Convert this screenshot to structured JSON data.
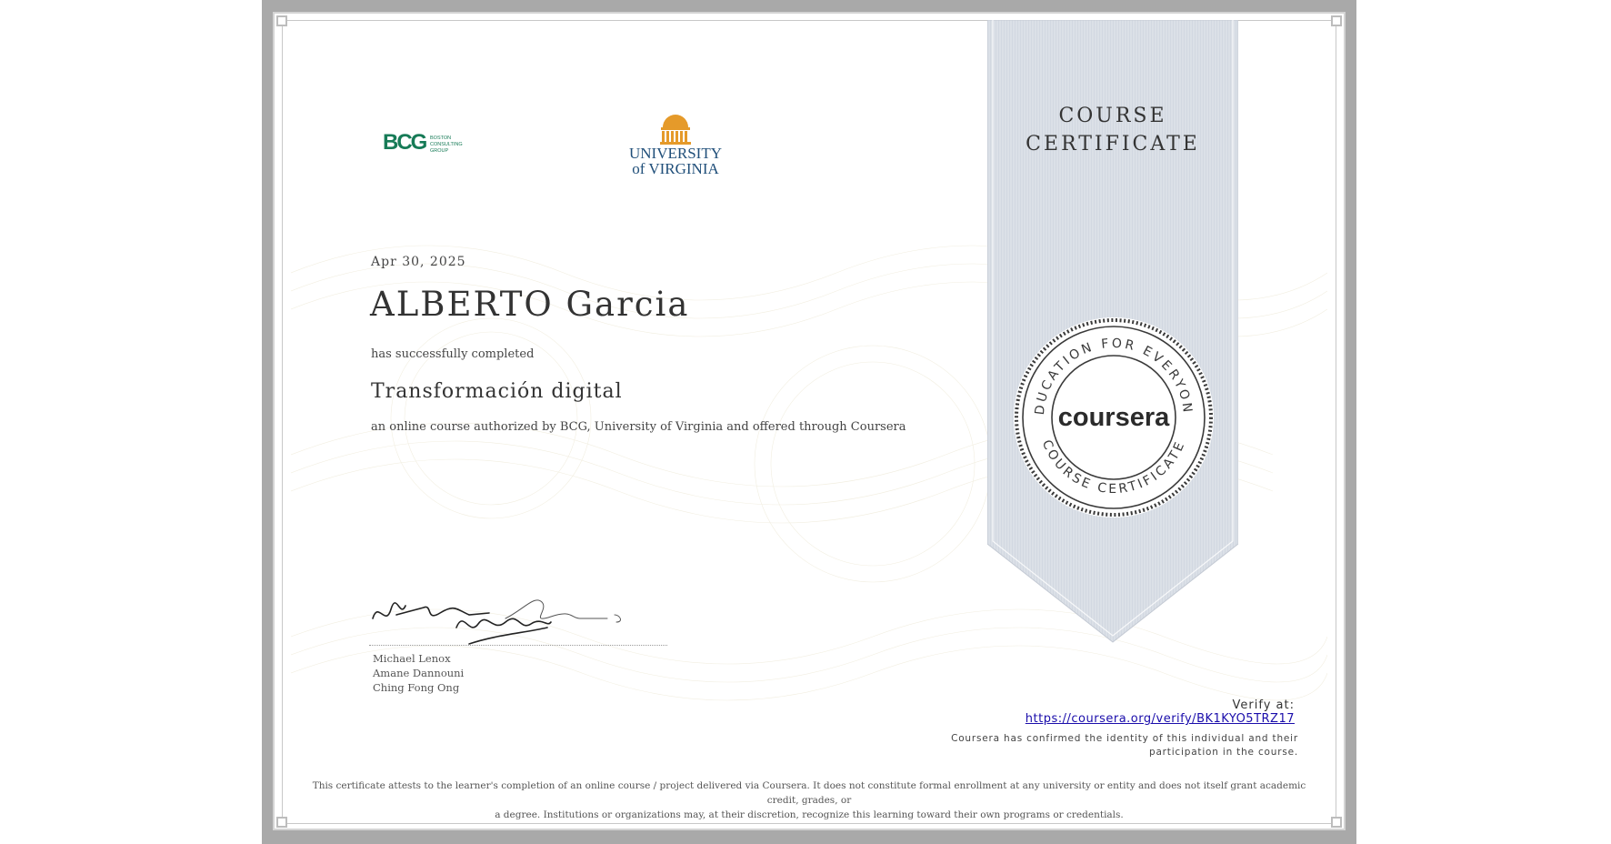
{
  "logos": {
    "bcg_mark": "BCG",
    "bcg_text": [
      "BOSTON",
      "CONSULTING",
      "GROUP"
    ],
    "uva_line1": "UNIVERSITY",
    "uva_line2": "of VIRGINIA"
  },
  "certificate": {
    "ribbon_title_line1": "COURSE",
    "ribbon_title_line2": "CERTIFICATE",
    "date": "Apr 30, 2025",
    "recipient_name": "ALBERTO Garcia",
    "completed_text": "has successfully completed",
    "course_title": "Transformación digital",
    "course_description": "an online course authorized by BCG, University of Virginia and offered through Coursera"
  },
  "signers": [
    "Michael Lenox",
    "Amane Dannouni",
    "Ching Fong Ong"
  ],
  "seal": {
    "top_arc": "EDUCATION FOR EVERYONE",
    "bottom_arc": "COURSE CERTIFICATE",
    "brand": "coursera"
  },
  "verification": {
    "label": "Verify at:",
    "url": "https://coursera.org/verify/BK1KYO5TRZ17",
    "identity_line1": "Coursera has confirmed the identity of this individual and their",
    "identity_line2": "participation in the course."
  },
  "disclaimer": {
    "line1": "This certificate attests to the learner's completion of an online course / project delivered via Coursera. It does not constitute formal enrollment at any university or entity and does not itself grant academic credit, grades, or",
    "line2": "a degree. Institutions or organizations may, at their discretion, recognize this learning toward their own programs or credentials."
  },
  "colors": {
    "bcg_green": "#177b57",
    "uva_orange": "#e59a2a",
    "uva_blue": "#1f4e79",
    "ribbon": "#dbe0e7",
    "link": "#1a0dab"
  }
}
